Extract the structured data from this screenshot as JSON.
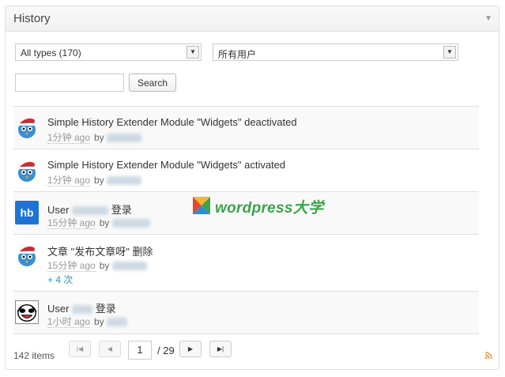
{
  "widget": {
    "title": "History"
  },
  "filters": {
    "type_select": "All types (170)",
    "user_select": "所有用户"
  },
  "search": {
    "placeholder": "",
    "button_label": "Search"
  },
  "items": [
    {
      "title": "Simple History Extender Module \"Widgets\" deactivated",
      "time": "1分钟 ago",
      "by": "by",
      "user": "coladu",
      "avatar": "bird-santa-icon"
    },
    {
      "title": "Simple History Extender Module \"Widgets\" activated",
      "time": "1分钟 ago",
      "by": "by",
      "user": "coladu",
      "avatar": "bird-santa-icon"
    },
    {
      "title_prefix": "User",
      "title_user": "dylanhe",
      "title_suffix": "登录",
      "time": "15分钟 ago",
      "by": "by",
      "user": "dylanhe",
      "avatar": "hb-logo-icon",
      "avatar_text": "hb"
    },
    {
      "title": "文章 \"发布文章呀\" 删除",
      "time": "15分钟 ago",
      "by": "by",
      "user": "coladu",
      "more": "+ 4 次",
      "avatar": "bird-santa-icon"
    },
    {
      "title_prefix": "User",
      "title_user": "bing",
      "title_suffix": "登录",
      "time": "1小时 ago",
      "by": "by",
      "user": "bing",
      "avatar": "panda-face-icon"
    }
  ],
  "pagination": {
    "item_count": "142 items",
    "current_page": "1",
    "total_pages": "/ 29"
  },
  "watermark": {
    "text": "wordpress大学"
  },
  "colors": {
    "border": "#dfdfdf",
    "link": "#2a95c5",
    "meta": "#999999",
    "watermark_green": "#3aa54a",
    "hb_blue": "#1e74d6"
  }
}
